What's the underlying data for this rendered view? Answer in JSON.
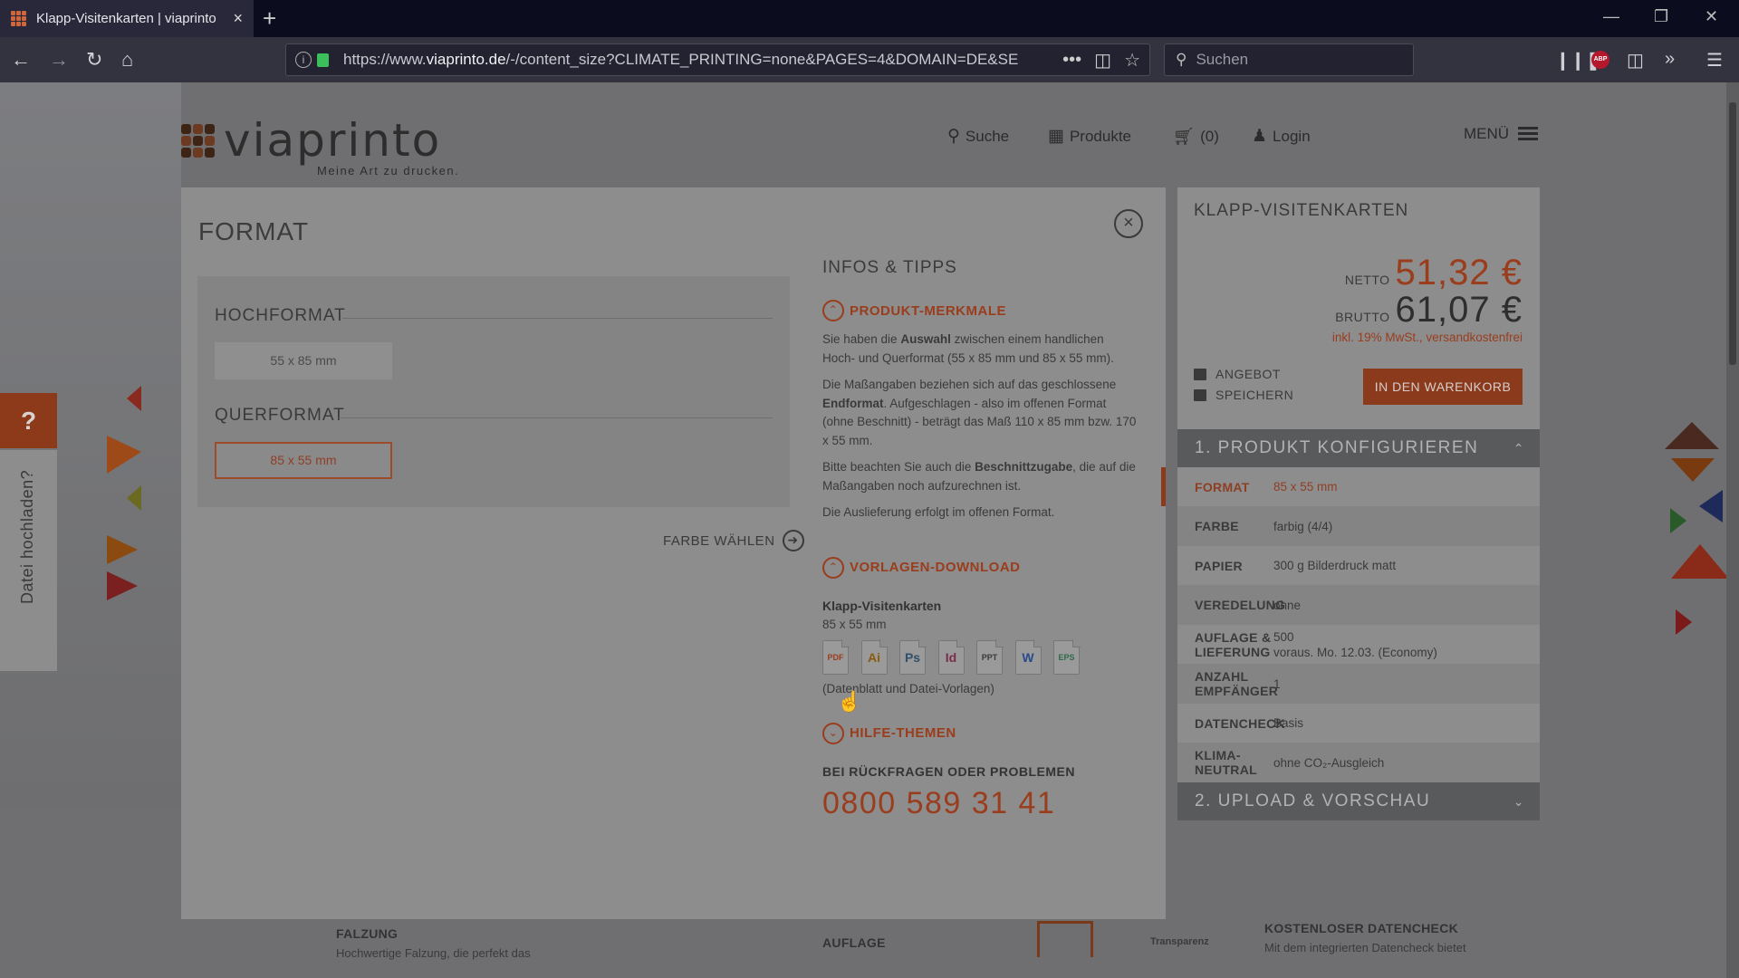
{
  "browser": {
    "tab_title": "Klapp-Visitenkarten | viaprinto",
    "tab_close": "×",
    "new_tab": "+",
    "url_prefix": "https://www.",
    "url_domain": "viaprinto.de",
    "url_rest": "/-/content_size?CLIMATE_PRINTING=none&PAGES=4&DOMAIN=DE&SE",
    "url_more": "•••",
    "search_placeholder": "Suchen",
    "window_controls": [
      "—",
      "❐",
      "✕"
    ]
  },
  "site": {
    "logo_text": "viaprinto",
    "logo_tagline": "Meine Art zu drucken.",
    "nav": {
      "search": "Suche",
      "products": "Produkte",
      "cart": "(0)",
      "login": "Login",
      "menu": "MENÜ"
    }
  },
  "modal": {
    "title": "FORMAT",
    "close": "×",
    "hochformat_label": "HOCHFORMAT",
    "hochformat_option": "55 x 85 mm",
    "querformat_label": "QUERFORMAT",
    "querformat_option": "85 x 55 mm",
    "next_label": "FARBE WÄHLEN",
    "info": {
      "heading": "INFOS & TIPPS",
      "section1_title": "PRODUKT-MERKMALE",
      "p1_a": "Sie haben die ",
      "p1_b": "Auswahl",
      "p1_c": " zwischen einem handlichen Hoch- und Querformat (55 x 85 mm und 85 x 55 mm).",
      "p2_a": "Die Maßangaben beziehen sich auf das geschlossene ",
      "p2_b": "Endformat",
      "p2_c": ". Aufgeschlagen - also im offenen Format (ohne Beschnitt) - beträgt das Maß 110 x 85 mm bzw. 170 x 55 mm.",
      "p3_a": "Bitte beachten Sie auch die ",
      "p3_b": "Beschnittzugabe",
      "p3_c": ", die auf die Maßangaben noch aufzurechnen ist.",
      "p4": "Die Auslieferung erfolgt im offenen Format.",
      "section2_title": "VORLAGEN-DOWNLOAD",
      "download_name": "Klapp-Visitenkarten",
      "download_size": "85 x 55 mm",
      "file_types": [
        {
          "label": "PDF",
          "color": "#9a3d1c"
        },
        {
          "label": "Ai",
          "color": "#8a5a10"
        },
        {
          "label": "Ps",
          "color": "#2f4f6a"
        },
        {
          "label": "Id",
          "color": "#7a2d4a"
        },
        {
          "label": "PPT",
          "color": "#3a3a3a"
        },
        {
          "label": "W",
          "color": "#2a4a8a"
        },
        {
          "label": "EPS",
          "color": "#2e6a4a"
        }
      ],
      "download_note": "(Datenblatt und Datei-Vorlagen)",
      "section3_title": "HILFE-THEMEN",
      "contact_heading": "BEI RÜCKFRAGEN ODER PROBLEMEN",
      "phone": "0800 589 31 41"
    }
  },
  "sidebar": {
    "product_name": "KLAPP-VISITENKARTEN",
    "netto_label": "NETTO",
    "netto_value": "51,32 €",
    "brutto_label": "BRUTTO",
    "brutto_value": "61,07 €",
    "tax_note": "inkl. 19% MwSt., versandkostenfrei",
    "offer_label": "ANGEBOT",
    "save_label": "SPEICHERN",
    "cart_button": "IN DEN WARENKORB",
    "step1": "1. PRODUKT KONFIGURIEREN",
    "config": [
      {
        "key": "FORMAT",
        "value": "85 x 55 mm"
      },
      {
        "key": "FARBE",
        "value": "farbig (4/4)"
      },
      {
        "key": "PAPIER",
        "value": "300 g Bilderdruck matt"
      },
      {
        "key": "VEREDELUNG",
        "value": "ohne"
      },
      {
        "key": "AUFLAGE & LIEFERUNG",
        "value": "500",
        "value2": "voraus. Mo. 12.03. (Economy)"
      },
      {
        "key": "ANZAHL EMPFÄNGER",
        "value": "1"
      },
      {
        "key": "DATENCHECK",
        "value": "Basis"
      },
      {
        "key": "KLIMA-NEUTRAL",
        "value": "ohne CO₂-Ausgleich"
      }
    ],
    "step2": "2. UPLOAD & VORSCHAU"
  },
  "left_widgets": {
    "help": "?",
    "upload": "Datei hochladen?"
  },
  "footer": {
    "falzung": "FALZUNG",
    "falzung_text": "Hochwertige Falzung, die perfekt das",
    "auflage": "AUFLAGE",
    "transparenz": "Transparenz",
    "datencheck": "KOSTENLOSER DATENCHECK",
    "datencheck_text": "Mit dem integrierten Datencheck bietet"
  },
  "colors": {
    "accent": "#d9531e",
    "overlay_dim": "rgba(0,0,0,0.45)"
  }
}
